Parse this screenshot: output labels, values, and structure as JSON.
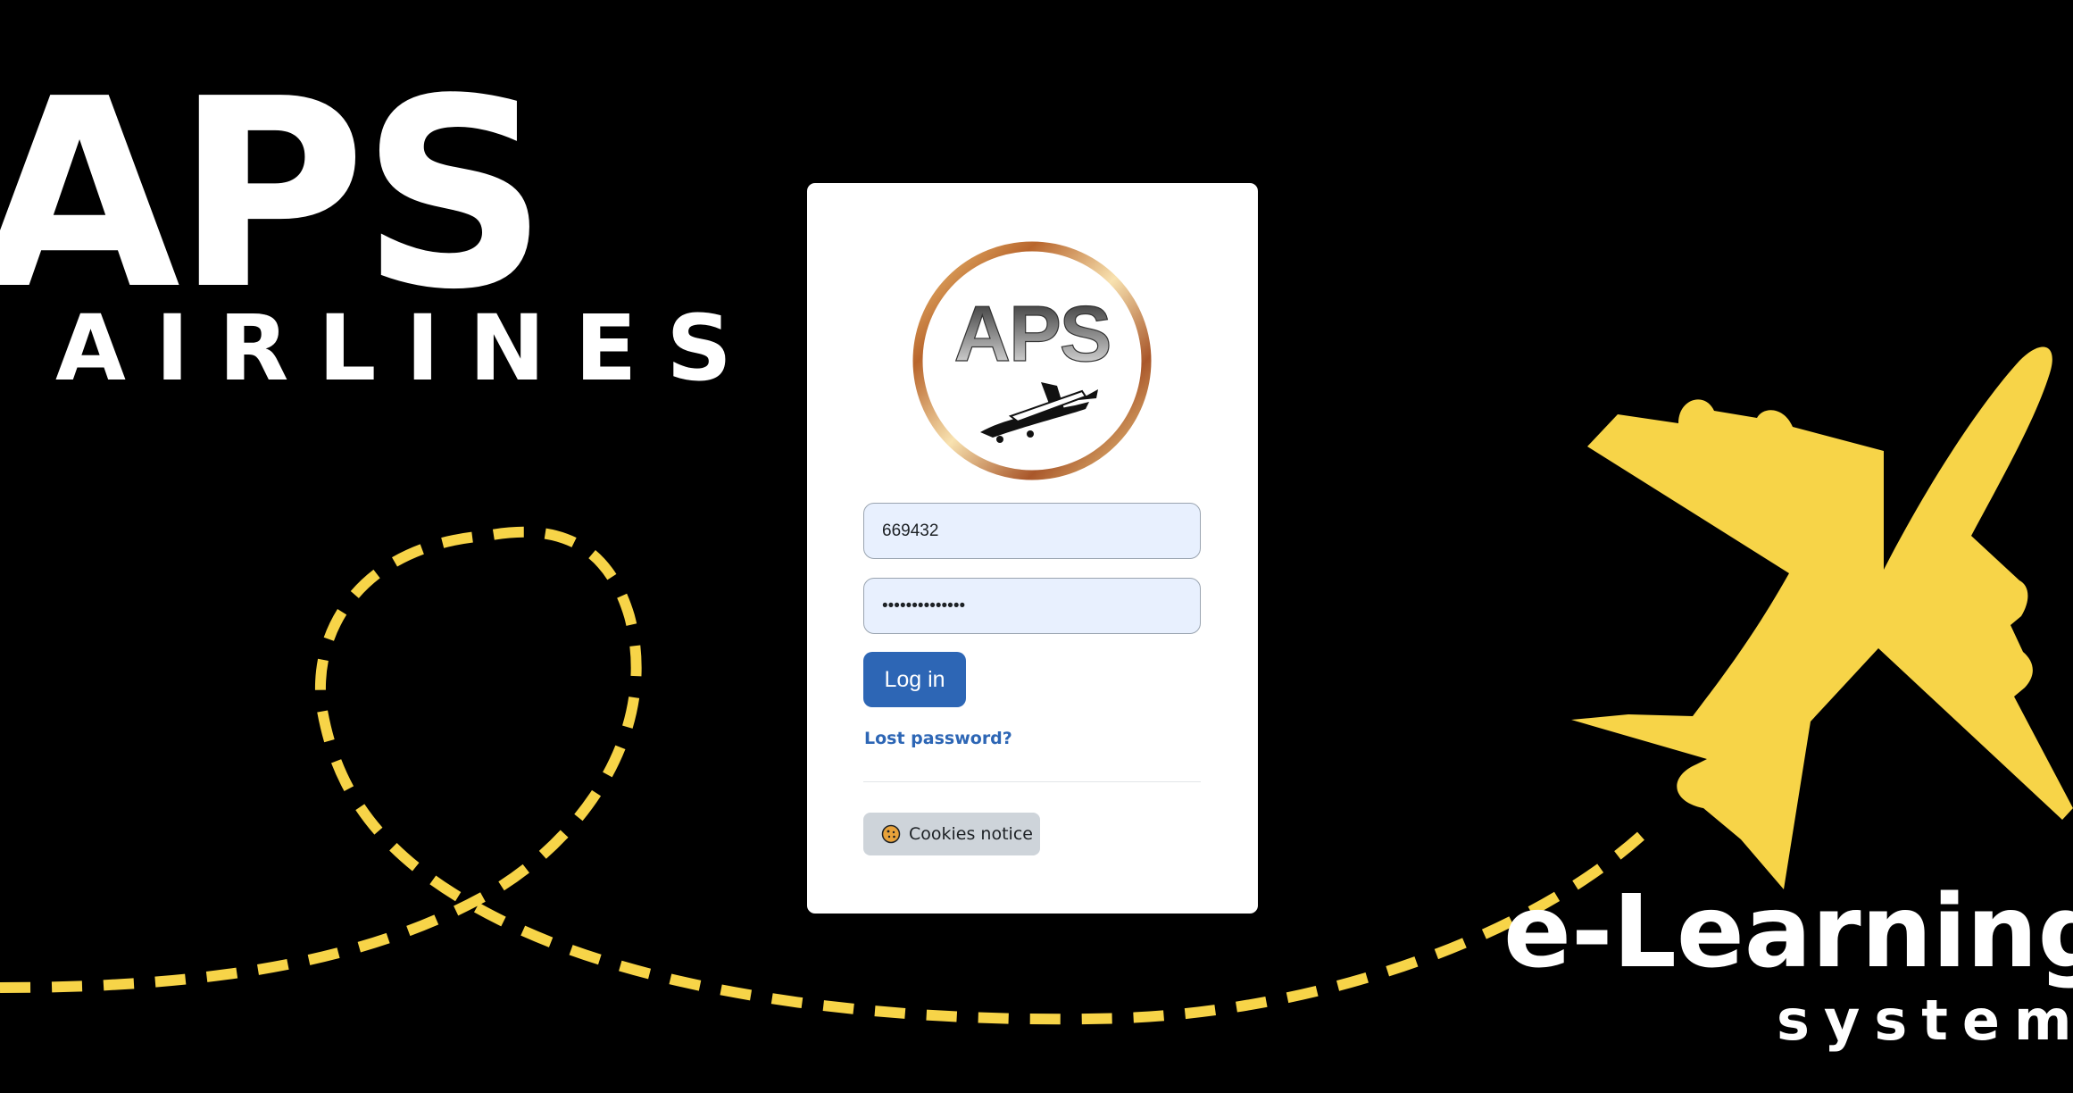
{
  "brand": {
    "name": "APS",
    "subtitle": "AIRLINES",
    "tagline": "e-Learning",
    "tagline_sub": "system"
  },
  "logo": {
    "text": "APS"
  },
  "login": {
    "username_value": "669432",
    "password_value": "••••••••••••••",
    "login_button": "Log in",
    "lost_password": "Lost password?",
    "cookies_notice": "Cookies notice"
  },
  "colors": {
    "background": "#000000",
    "accent_yellow": "#f7d448",
    "primary_blue": "#2d66b5",
    "card": "#ffffff",
    "input_fill": "#e8f0fe",
    "secondary_button": "#ced4da"
  },
  "icons": {
    "airplane": "airplane-icon",
    "cookie": "cookie-icon",
    "logo_plane": "small-plane-icon"
  }
}
